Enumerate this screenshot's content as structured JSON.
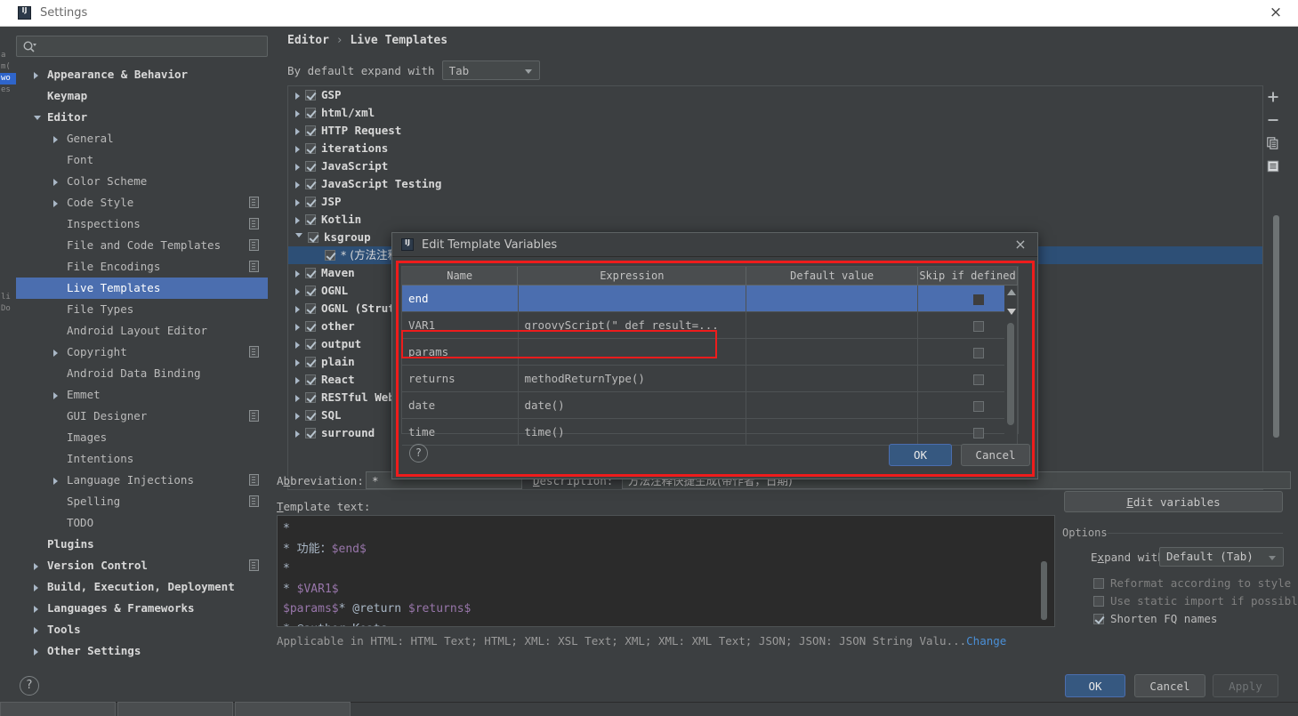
{
  "window": {
    "title": "Settings",
    "icon": "intellij-icon",
    "close_label": "×"
  },
  "search": {
    "placeholder": "",
    "value": "",
    "icon": "search-icon"
  },
  "sidebar": {
    "items": [
      {
        "label": "Appearance & Behavior",
        "arrow": "right",
        "indent": 0,
        "bold": true,
        "cfg": false,
        "selected": false
      },
      {
        "label": "Keymap",
        "arrow": "none",
        "indent": 0,
        "bold": true,
        "cfg": false,
        "selected": false
      },
      {
        "label": "Editor",
        "arrow": "down",
        "indent": 0,
        "bold": true,
        "cfg": false,
        "selected": false
      },
      {
        "label": "General",
        "arrow": "right",
        "indent": 1,
        "bold": false,
        "cfg": false,
        "selected": false
      },
      {
        "label": "Font",
        "arrow": "none",
        "indent": 1,
        "bold": false,
        "cfg": false,
        "selected": false
      },
      {
        "label": "Color Scheme",
        "arrow": "right",
        "indent": 1,
        "bold": false,
        "cfg": false,
        "selected": false
      },
      {
        "label": "Code Style",
        "arrow": "right",
        "indent": 1,
        "bold": false,
        "cfg": true,
        "selected": false
      },
      {
        "label": "Inspections",
        "arrow": "none",
        "indent": 1,
        "bold": false,
        "cfg": true,
        "selected": false
      },
      {
        "label": "File and Code Templates",
        "arrow": "none",
        "indent": 1,
        "bold": false,
        "cfg": true,
        "selected": false
      },
      {
        "label": "File Encodings",
        "arrow": "none",
        "indent": 1,
        "bold": false,
        "cfg": true,
        "selected": false
      },
      {
        "label": "Live Templates",
        "arrow": "none",
        "indent": 1,
        "bold": false,
        "cfg": false,
        "selected": true
      },
      {
        "label": "File Types",
        "arrow": "none",
        "indent": 1,
        "bold": false,
        "cfg": false,
        "selected": false
      },
      {
        "label": "Android Layout Editor",
        "arrow": "none",
        "indent": 1,
        "bold": false,
        "cfg": false,
        "selected": false
      },
      {
        "label": "Copyright",
        "arrow": "right",
        "indent": 1,
        "bold": false,
        "cfg": true,
        "selected": false
      },
      {
        "label": "Android Data Binding",
        "arrow": "none",
        "indent": 1,
        "bold": false,
        "cfg": false,
        "selected": false
      },
      {
        "label": "Emmet",
        "arrow": "right",
        "indent": 1,
        "bold": false,
        "cfg": false,
        "selected": false
      },
      {
        "label": "GUI Designer",
        "arrow": "none",
        "indent": 1,
        "bold": false,
        "cfg": true,
        "selected": false
      },
      {
        "label": "Images",
        "arrow": "none",
        "indent": 1,
        "bold": false,
        "cfg": false,
        "selected": false
      },
      {
        "label": "Intentions",
        "arrow": "none",
        "indent": 1,
        "bold": false,
        "cfg": false,
        "selected": false
      },
      {
        "label": "Language Injections",
        "arrow": "right",
        "indent": 1,
        "bold": false,
        "cfg": true,
        "selected": false
      },
      {
        "label": "Spelling",
        "arrow": "none",
        "indent": 1,
        "bold": false,
        "cfg": true,
        "selected": false
      },
      {
        "label": "TODO",
        "arrow": "none",
        "indent": 1,
        "bold": false,
        "cfg": false,
        "selected": false
      },
      {
        "label": "Plugins",
        "arrow": "none",
        "indent": 0,
        "bold": true,
        "cfg": false,
        "selected": false
      },
      {
        "label": "Version Control",
        "arrow": "right",
        "indent": 0,
        "bold": true,
        "cfg": true,
        "selected": false
      },
      {
        "label": "Build, Execution, Deployment",
        "arrow": "right",
        "indent": 0,
        "bold": true,
        "cfg": false,
        "selected": false
      },
      {
        "label": "Languages & Frameworks",
        "arrow": "right",
        "indent": 0,
        "bold": true,
        "cfg": false,
        "selected": false
      },
      {
        "label": "Tools",
        "arrow": "right",
        "indent": 0,
        "bold": true,
        "cfg": false,
        "selected": false
      },
      {
        "label": "Other Settings",
        "arrow": "right",
        "indent": 0,
        "bold": true,
        "cfg": false,
        "selected": false
      }
    ]
  },
  "content": {
    "breadcrumb_root": "Editor",
    "breadcrumb_sep": "›",
    "breadcrumb_leaf": "Live Templates",
    "expand_label": "By default expand with",
    "expand_value": "Tab",
    "templates": [
      {
        "label": "GSP",
        "arrow": "right",
        "checked": true,
        "indent": 0,
        "selected": false,
        "cjk": false
      },
      {
        "label": "html/xml",
        "arrow": "right",
        "checked": true,
        "indent": 0,
        "selected": false,
        "cjk": false
      },
      {
        "label": "HTTP Request",
        "arrow": "right",
        "checked": true,
        "indent": 0,
        "selected": false,
        "cjk": false
      },
      {
        "label": "iterations",
        "arrow": "right",
        "checked": true,
        "indent": 0,
        "selected": false,
        "cjk": false
      },
      {
        "label": "JavaScript",
        "arrow": "right",
        "checked": true,
        "indent": 0,
        "selected": false,
        "cjk": false
      },
      {
        "label": "JavaScript Testing",
        "arrow": "right",
        "checked": true,
        "indent": 0,
        "selected": false,
        "cjk": false
      },
      {
        "label": "JSP",
        "arrow": "right",
        "checked": true,
        "indent": 0,
        "selected": false,
        "cjk": false
      },
      {
        "label": "Kotlin",
        "arrow": "right",
        "checked": true,
        "indent": 0,
        "selected": false,
        "cjk": false
      },
      {
        "label": "ksgroup",
        "arrow": "down",
        "checked": true,
        "indent": 0,
        "selected": false,
        "cjk": false
      },
      {
        "label": "* (方法注释",
        "arrow": "none",
        "checked": true,
        "indent": 1,
        "selected": true,
        "cjk": true
      },
      {
        "label": "Maven",
        "arrow": "right",
        "checked": true,
        "indent": 0,
        "selected": false,
        "cjk": false
      },
      {
        "label": "OGNL",
        "arrow": "right",
        "checked": true,
        "indent": 0,
        "selected": false,
        "cjk": false
      },
      {
        "label": "OGNL (Struts",
        "arrow": "right",
        "checked": true,
        "indent": 0,
        "selected": false,
        "cjk": false
      },
      {
        "label": "other",
        "arrow": "right",
        "checked": true,
        "indent": 0,
        "selected": false,
        "cjk": false
      },
      {
        "label": "output",
        "arrow": "right",
        "checked": true,
        "indent": 0,
        "selected": false,
        "cjk": false
      },
      {
        "label": "plain",
        "arrow": "right",
        "checked": true,
        "indent": 0,
        "selected": false,
        "cjk": false
      },
      {
        "label": "React",
        "arrow": "right",
        "checked": true,
        "indent": 0,
        "selected": false,
        "cjk": false
      },
      {
        "label": "RESTful Web",
        "arrow": "right",
        "checked": true,
        "indent": 0,
        "selected": false,
        "cjk": false
      },
      {
        "label": "SQL",
        "arrow": "right",
        "checked": true,
        "indent": 0,
        "selected": false,
        "cjk": false
      },
      {
        "label": "surround",
        "arrow": "right",
        "checked": true,
        "indent": 0,
        "selected": false,
        "cjk": false
      }
    ],
    "toolbar": [
      {
        "name": "add-button",
        "glyph": "+"
      },
      {
        "name": "remove-button",
        "glyph": "−"
      },
      {
        "name": "copy-button",
        "glyph": "copy"
      },
      {
        "name": "duplicate-button",
        "glyph": "duplicate"
      }
    ],
    "abbreviation_label": "Abbreviation:",
    "abbreviation_value": "*",
    "description_label": "Description:",
    "description_value": "方法注释快捷生成(带作者，日期)",
    "template_text_label": "Template text:",
    "template_lines": [
      {
        "plain": "*",
        "parts": [
          {
            "t": "*",
            "k": "p"
          }
        ]
      },
      {
        "parts": [
          {
            "t": " * ",
            "k": "p"
          },
          {
            "t": "功能：",
            "k": "cjk"
          },
          {
            "t": "$end$",
            "k": "v"
          }
        ]
      },
      {
        "parts": [
          {
            "t": " *",
            "k": "p"
          }
        ]
      },
      {
        "parts": [
          {
            "t": " * ",
            "k": "p"
          },
          {
            "t": "$VAR1$",
            "k": "v"
          }
        ]
      },
      {
        "parts": [
          {
            "t": "$params$",
            "k": "v"
          },
          {
            "t": "* @return ",
            "k": "p"
          },
          {
            "t": "$returns$",
            "k": "v"
          }
        ]
      },
      {
        "parts": [
          {
            "t": " * @author Keats",
            "k": "p"
          }
        ]
      }
    ],
    "applicable_text": "Applicable in HTML: HTML Text; HTML; XML: XSL Text; XML; XML: XML Text; JSON; JSON: JSON String Valu...",
    "applicable_change": "Change",
    "edit_variables_label": "Edit variables",
    "options_title": "Options",
    "expand_with_label": "Expand with",
    "expand_with_value": "Default (Tab)",
    "checkboxes": [
      {
        "label": "Reformat according to style",
        "checked": false,
        "disabled": true
      },
      {
        "label": "Use static import if possible",
        "checked": false,
        "disabled": true
      },
      {
        "label": "Shorten FQ names",
        "checked": true,
        "disabled": false
      }
    ]
  },
  "dialog": {
    "title": "Edit Template Variables",
    "icon": "intellij-icon",
    "close_label": "×",
    "columns": [
      "Name",
      "Expression",
      "Default value",
      "Skip if defined"
    ],
    "rows": [
      {
        "name": "end",
        "expression": "",
        "default": "",
        "skip": false,
        "selected": true,
        "highlighted": false
      },
      {
        "name": "VAR1",
        "expression": "groovyScript(\" def result=...",
        "default": "",
        "skip": false,
        "selected": false,
        "highlighted": true
      },
      {
        "name": "params",
        "expression": "",
        "default": "",
        "skip": false,
        "selected": false,
        "highlighted": false
      },
      {
        "name": "returns",
        "expression": "methodReturnType()",
        "default": "",
        "skip": false,
        "selected": false,
        "highlighted": false
      },
      {
        "name": "date",
        "expression": "date()",
        "default": "",
        "skip": false,
        "selected": false,
        "highlighted": false
      },
      {
        "name": "time",
        "expression": "time()",
        "default": "",
        "skip": false,
        "selected": false,
        "highlighted": false
      }
    ],
    "help_label": "?",
    "ok_label": "OK",
    "cancel_label": "Cancel"
  },
  "footer": {
    "help_label": "?",
    "ok_label": "OK",
    "cancel_label": "Cancel",
    "apply_label": "Apply"
  },
  "background_ide": {
    "fragments": [
      "a",
      "m(",
      "wo",
      "es",
      "li",
      "Do"
    ]
  },
  "colors": {
    "accent_blue": "#4b6eaf",
    "selection_blue": "#2d4f76",
    "highlight_red": "#ee1c1c",
    "panel_bg": "#3c3f41",
    "editor_bg": "#2b2b2b",
    "variable_purple": "#9876aa",
    "link_blue": "#4a8fd6"
  }
}
